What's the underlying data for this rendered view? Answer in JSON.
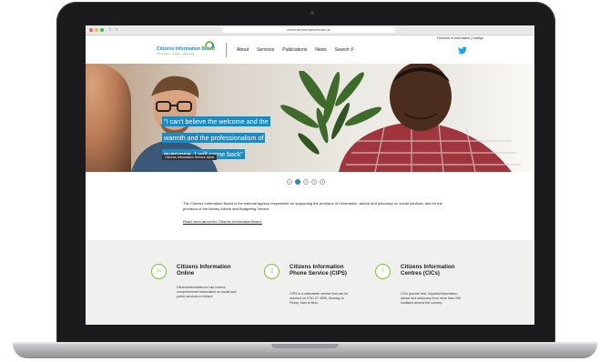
{
  "browser": {
    "url": "citizensinformationboard.ie"
  },
  "header": {
    "top_links": "Freedom of Information | Gaeilge",
    "logo_name": "Citizens Information Board",
    "logo_tagline": "information · advice · advocacy",
    "nav": [
      "About",
      "Services",
      "Publications",
      "News",
      "Search"
    ],
    "search_icon": "magnifier-icon",
    "social_icon": "twitter-icon"
  },
  "hero": {
    "quote_lines": [
      "\"I can't believe the welcome and the",
      "warmth and the professionalism of",
      "everyone, I will come back\""
    ],
    "attribution": "Citizens Information Service client"
  },
  "carousel": {
    "pages": [
      "1",
      "2",
      "3",
      "4",
      "5"
    ],
    "active_index": 1
  },
  "intro": {
    "text": "The Citizens Information Board is the national agency responsible for supporting the provision of information, advice and advocacy on social services, and for the provision of the Money Advice and Budgeting Service.",
    "link": "Read more about the Citizens Information Board."
  },
  "services": [
    {
      "title": "Citizens Information Online",
      "text": "Citizensinformation.ie has current, comprehensive information on social and public services in Ireland.",
      "icon": "laptop-icon"
    },
    {
      "title": "Citizens Information Phone Service (CIPS)",
      "text": "CIPS is a nationwide service that can be reached on 0761 07 4000, Monday to Friday, 9am to 8pm.",
      "icon": "phone-icon"
    },
    {
      "title": "Citizens Information Centres (CICs)",
      "text": "CICs provide free, impartial information, advice and advocacy from more than 260 locations around the country.",
      "icon": "info-icon"
    }
  ],
  "colors": {
    "brand_blue": "#2b88b8",
    "brand_green": "#7ac143",
    "twitter_blue": "#1da1f2"
  }
}
